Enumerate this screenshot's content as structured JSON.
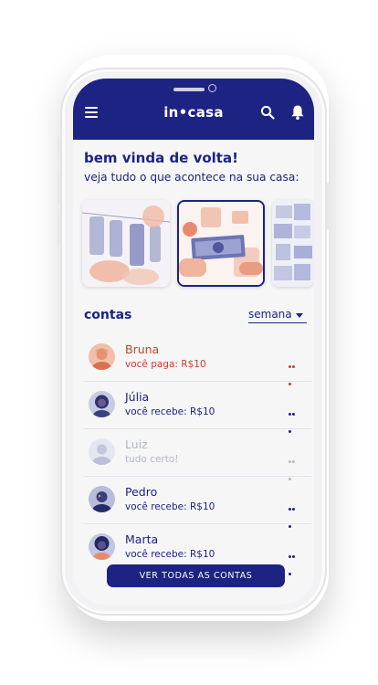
{
  "app": {
    "logo": "in•casa"
  },
  "header": {
    "menu_icon": "menu-icon",
    "search_icon": "search-icon",
    "notifications_icon": "bell-icon"
  },
  "greeting": {
    "title": "bem vinda de volta!",
    "subtitle": "veja tudo o que acontece na sua casa:"
  },
  "carousel": {
    "cards": [
      {
        "image": "laundry-clothesline"
      },
      {
        "image": "money-bills-hands",
        "selected": true
      },
      {
        "image": "notes-board"
      }
    ]
  },
  "accounts": {
    "title": "contas",
    "period": "semana",
    "items": [
      {
        "name": "Bruna",
        "status": "você paga: R$10",
        "state": "pay"
      },
      {
        "name": "Júlia",
        "status": "você recebe: R$10",
        "state": "receive"
      },
      {
        "name": "Luiz",
        "status": "tudo certo!",
        "state": "settled"
      },
      {
        "name": "Pedro",
        "status": "você recebe: R$10",
        "state": "receive"
      },
      {
        "name": "Marta",
        "status": "você recebe: R$10",
        "state": "receive"
      }
    ],
    "view_all_label": "VER TODAS AS CONTAS"
  },
  "colors": {
    "brand": "#1c2382",
    "alert": "#c9402a",
    "muted": "#b4b6c8",
    "background": "#f6f6f7"
  }
}
